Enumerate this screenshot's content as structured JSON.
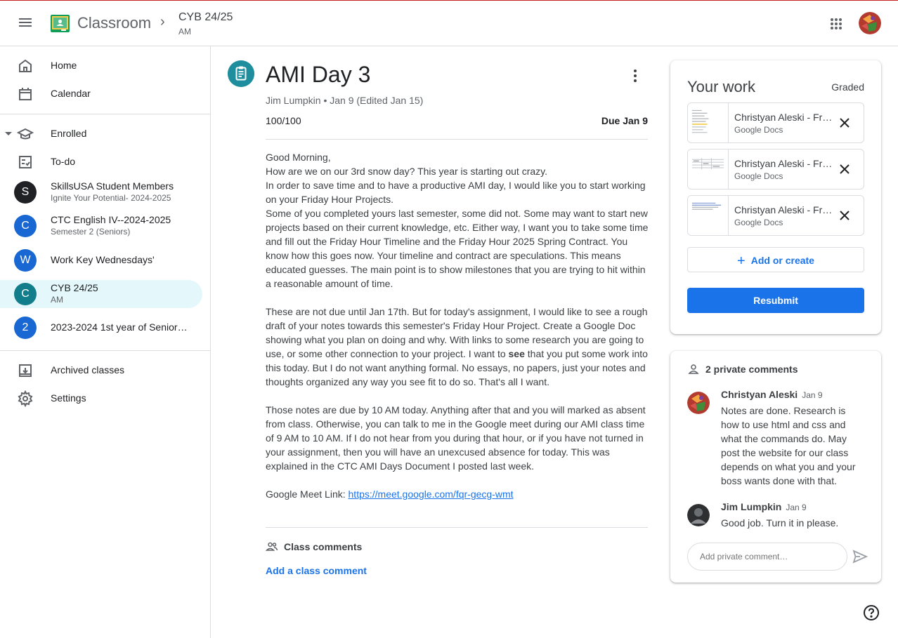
{
  "header": {
    "app_title": "Classroom",
    "course_title": "CYB 24/25",
    "course_section": "AM"
  },
  "sidebar": {
    "home": "Home",
    "calendar": "Calendar",
    "enrolled": "Enrolled",
    "todo": "To-do",
    "classes": [
      {
        "initial": "S",
        "name": "SkillsUSA Student Members",
        "sub": "Ignite Your Potential- 2024-2025",
        "color": "#202124"
      },
      {
        "initial": "C",
        "name": "CTC English IV--2024-2025",
        "sub": "Semester 2 (Seniors)",
        "color": "#1967d2"
      },
      {
        "initial": "W",
        "name": "Work Key Wednesdays'",
        "sub": "",
        "color": "#1967d2"
      },
      {
        "initial": "C",
        "name": "CYB 24/25",
        "sub": "AM",
        "color": "#137e8b"
      },
      {
        "initial": "2",
        "name": "2023-2024 1st year of Senior…",
        "sub": "",
        "color": "#1967d2"
      }
    ],
    "archived": "Archived classes",
    "settings": "Settings"
  },
  "assignment": {
    "title": "AMI Day 3",
    "meta": "Jim Lumpkin • Jan 9 (Edited Jan 15)",
    "points_earned": "100",
    "points_total": "/100",
    "due": "Due Jan 9",
    "body": {
      "p1": [
        "Good Morning,",
        "How are we on our 3rd snow day?  This year is starting out crazy.",
        "In order to save time and to have a productive AMI day, I would like you to start working on your Friday Hour Projects.",
        "Some of you completed yours last semester, some did not. Some may want to start new projects based on their current knowledge, etc. Either way, I want you to take some time and fill out the Friday Hour Timeline and the Friday Hour 2025 Spring Contract. You know how this goes now. Your timeline and contract are speculations. This means educated guesses.  The main point is to show milestones that you are trying to hit within a reasonable amount of time."
      ],
      "p2_before": "These are not due until Jan 17th.  But for today's assignment, I would like to see a rough draft of your notes towards this semester's Friday Hour Project.  Create a Google Doc showing what you plan on doing and why.  With links to some research you are going to use, or some other connection to your project. I want to ",
      "p2_bold": "see",
      "p2_after": " that you put some work into this today.  But I do not want anything formal.  No essays, no papers, just your notes and thoughts organized any way you see fit to do so.  That's all I want.",
      "p3": "Those notes are due by 10 AM today.  Anything after that and you will marked as absent from class.  Otherwise, you can talk to me in the Google meet during our AMI class time of 9 AM to 10 AM.  If I do not hear from you during that hour, or if you have not turned in your assignment, then you will have an unexcused absence for today.  This was explained in the CTC AMI Days Document I posted last week.",
      "meet_label": "Google Meet Link: ",
      "meet_link": "https://meet.google.com/fqr-gecg-wmt"
    },
    "class_comments_label": "Class comments",
    "add_class_comment": "Add a class comment"
  },
  "your_work": {
    "title": "Your work",
    "status": "Graded",
    "attachments": [
      {
        "name": "Christyan Aleski - Friday Hour Notes",
        "type": "Google Docs"
      },
      {
        "name": "Christyan Aleski - Friday Hour Timeline",
        "type": "Google Docs"
      },
      {
        "name": "Christyan Aleski - Friday Hour Contract",
        "type": "Google Docs"
      }
    ],
    "add_or_create": "Add or create",
    "resubmit": "Resubmit"
  },
  "private_comments": {
    "label": "2 private comments",
    "comments": [
      {
        "author": "Christyan Aleski",
        "date": "Jan 9",
        "text": "Notes are done. Research is how to use html and css and what the commands do. May post the website for our class depends on what you and your boss wants done with that."
      },
      {
        "author": "Jim Lumpkin",
        "date": "Jan 9",
        "text": "Good job. Turn it in please."
      }
    ],
    "input_placeholder": "Add private comment…"
  },
  "colors": {
    "accent": "#1a73e8",
    "assignment_badge": "#1e8e9e",
    "active_nav": "#e4f7fb"
  }
}
